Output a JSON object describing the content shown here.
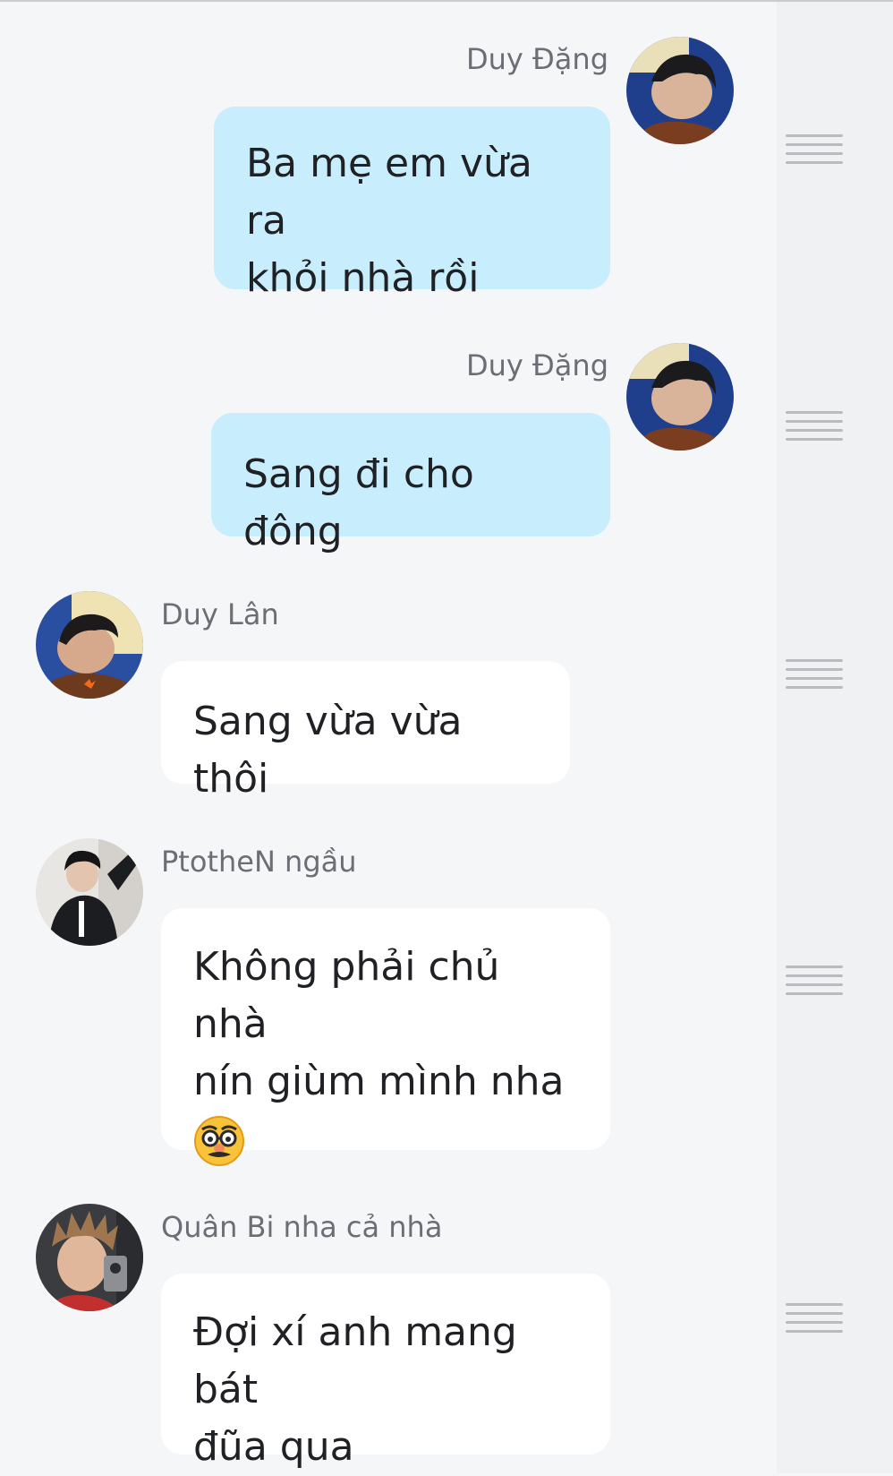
{
  "messages": [
    {
      "sender": "Duy Đặng",
      "direction": "outgoing",
      "avatar": "avatar-duy-dang",
      "lines": [
        "Ba mẹ em vừa ra",
        "khỏi nhà rồi"
      ]
    },
    {
      "sender": "Duy Đặng",
      "direction": "outgoing",
      "avatar": "avatar-duy-dang",
      "lines": [
        "Sang đi cho đông"
      ]
    },
    {
      "sender": "Duy Lân",
      "direction": "incoming",
      "avatar": "avatar-duy-lan",
      "lines": [
        "Sang vừa vừa thôi"
      ]
    },
    {
      "sender": "PtotheN ngầu",
      "direction": "incoming",
      "avatar": "avatar-ptothen",
      "lines": [
        "Không phải chủ nhà",
        "nín giùm mình nha"
      ],
      "emoji": "disguised-face-emoji"
    },
    {
      "sender": "Quân Bi nha cả nhà",
      "direction": "incoming",
      "avatar": "avatar-quan-bi",
      "lines": [
        "Đợi xí anh mang bát",
        "đũa qua"
      ]
    }
  ],
  "colors": {
    "background": "#f5f6f8",
    "outgoing_bubble": "#c8edfd",
    "incoming_bubble": "#ffffff",
    "sender_name": "#6b6e74",
    "message_text": "#1f2124",
    "drag_handle": "#b9bbbf"
  }
}
